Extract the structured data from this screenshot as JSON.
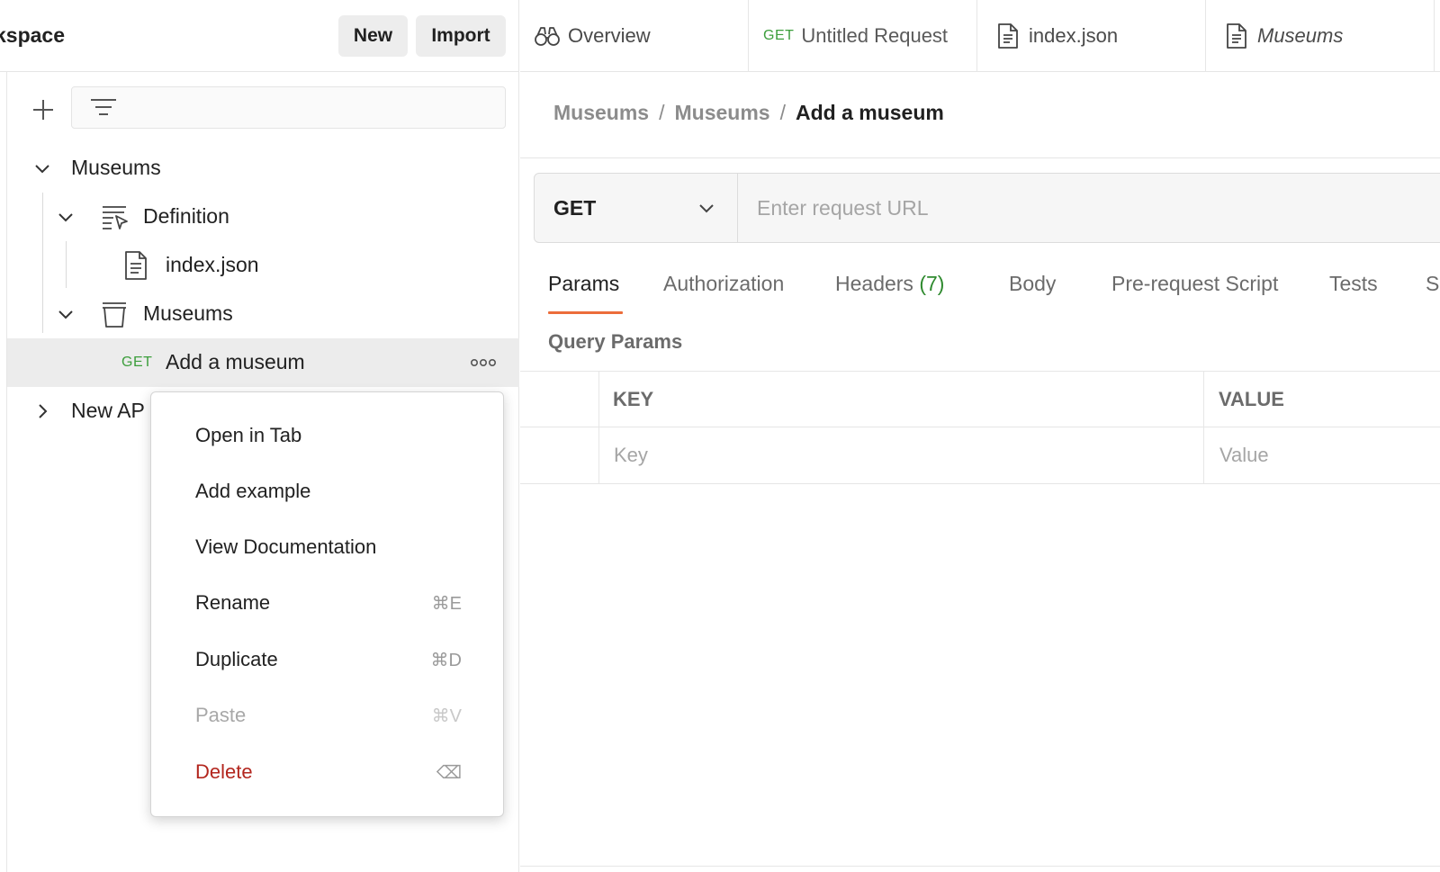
{
  "sidebar": {
    "workspace_title": "kspace",
    "new_label": "New",
    "import_label": "Import",
    "filter_placeholder": "",
    "tree": {
      "museums_label": "Museums",
      "definition_label": "Definition",
      "index_json_label": "index.json",
      "museums_folder_label": "Museums",
      "request_method": "GET",
      "request_label": "Add a museum",
      "new_api_label": "New AP"
    }
  },
  "context_menu": {
    "items": [
      {
        "label": "Open in Tab",
        "shortcut": ""
      },
      {
        "label": "Add example",
        "shortcut": ""
      },
      {
        "label": "View Documentation",
        "shortcut": ""
      },
      {
        "label": "Rename",
        "shortcut": "⌘E"
      },
      {
        "label": "Duplicate",
        "shortcut": "⌘D"
      },
      {
        "label": "Paste",
        "shortcut": "⌘V",
        "disabled": true
      },
      {
        "label": "Delete",
        "shortcut": "⌫",
        "danger": true
      }
    ]
  },
  "tabs": {
    "overview_label": "Overview",
    "untitled_method": "GET",
    "untitled_label": "Untitled Request",
    "index_label": "index.json",
    "museums_label": "Museums"
  },
  "breadcrumb": {
    "part1": "Museums",
    "part2": "Museums",
    "current": "Add a museum",
    "separator": "/"
  },
  "request": {
    "method": "GET",
    "url_placeholder": "Enter request URL",
    "url_value": ""
  },
  "request_tabs": {
    "params": "Params",
    "authorization": "Authorization",
    "headers": "Headers",
    "headers_count": "(7)",
    "body": "Body",
    "prerequest": "Pre-request Script",
    "tests": "Tests",
    "settings_partial": "S"
  },
  "query_params": {
    "title": "Query Params",
    "key_header": "KEY",
    "value_header": "VALUE",
    "key_placeholder": "Key",
    "value_placeholder": "Value"
  },
  "colors": {
    "accent_underline": "#ec6d3b",
    "get_method": "#3c9e3c",
    "danger": "#b3261e",
    "headers_count": "#2f8a2f"
  }
}
